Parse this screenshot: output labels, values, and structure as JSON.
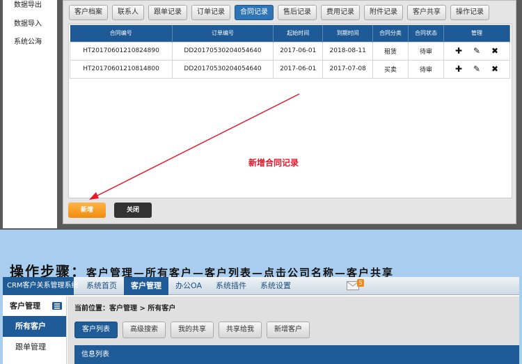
{
  "top": {
    "sidebar": [
      "数据导出",
      "数据导入",
      "系统公海"
    ],
    "tabs": [
      "客户档案",
      "联系人",
      "跟单记录",
      "订单记录",
      "合同记录",
      "售后记录",
      "费用记录",
      "附件记录",
      "客户共享",
      "操作记录"
    ],
    "active_tab": "合同记录",
    "table": {
      "headers": [
        "合同编号",
        "订单编号",
        "起始时间",
        "到期时间",
        "合同分类",
        "合同状态",
        "管理"
      ],
      "rows": [
        [
          "HT20170601210824890",
          "DD20170530204054640",
          "2017-06-01",
          "2018-08-11",
          "租赁",
          "待审"
        ],
        [
          "HT20170601210814800",
          "DD20170530204054640",
          "2017-06-01",
          "2017-07-08",
          "买卖",
          "待审"
        ]
      ]
    },
    "ops_icons": [
      "add-icon",
      "edit-icon",
      "delete-icon"
    ],
    "annotation": "新增合同记录",
    "buttons": {
      "new": "新增",
      "close": "关闭"
    }
  },
  "caption": {
    "head": "操作步骤：",
    "body": "客户管理—所有客户—客户列表—点击公司名称—客户共享"
  },
  "bottom": {
    "brand": "CRM客户关系管理系统",
    "menu": [
      "系统首页",
      "客户管理",
      "办公OA",
      "系统插件",
      "系统设置"
    ],
    "active_menu": "客户管理",
    "mail_count": "5",
    "side_title": "客户管理",
    "side_active": "所有客户",
    "side_item": "跟单管理",
    "breadcrumb": "当前位置：客户管理 > 所有客户",
    "actions": [
      "客户列表",
      "高级搜索",
      "我的共享",
      "共享给我",
      "新增客户"
    ],
    "list_title": "信息列表"
  },
  "colors": {
    "accent": "#1f5b96",
    "annotation": "#e8172a",
    "new_button": "#f28c0d",
    "background": "#a8cdee"
  }
}
